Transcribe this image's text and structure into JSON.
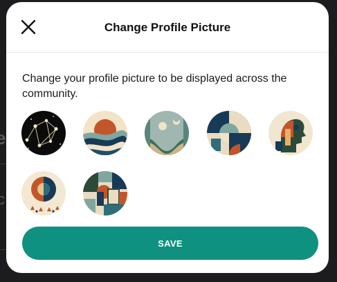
{
  "modal": {
    "title": "Change Profile Picture",
    "description": "Change your profile picture to be displayed across the community.",
    "close_icon": "close-icon",
    "save_label": "SAVE"
  },
  "avatars": [
    {
      "name": "constellation"
    },
    {
      "name": "sunset-waves"
    },
    {
      "name": "moon-landscape"
    },
    {
      "name": "geometric-abstract"
    },
    {
      "name": "profile-silhouette"
    },
    {
      "name": "sun-drops"
    },
    {
      "name": "geometric-blocks"
    }
  ],
  "colors": {
    "accent": "#0f9180",
    "navy": "#173a56",
    "orange": "#c2562a",
    "cream": "#f3e3c7",
    "teal": "#7fa7a0"
  },
  "background": {
    "frag_e": "e",
    "frag_c": "c"
  }
}
